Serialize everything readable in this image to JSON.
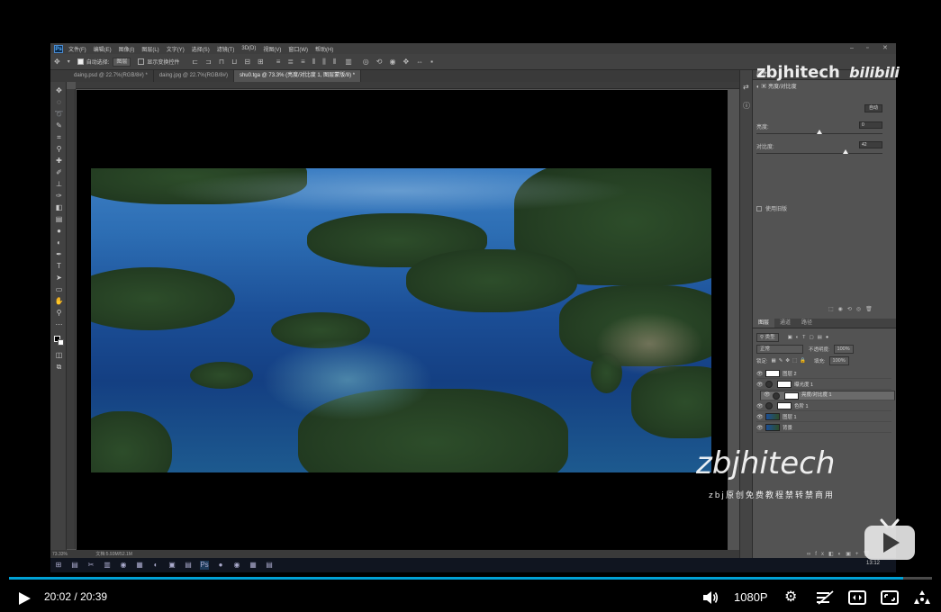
{
  "ps": {
    "logo": "Ps",
    "menu": [
      "文件(F)",
      "编辑(E)",
      "图像(I)",
      "图层(L)",
      "文字(Y)",
      "选择(S)",
      "滤镜(T)",
      "3D(D)",
      "视图(V)",
      "窗口(W)",
      "帮助(H)"
    ],
    "options": {
      "auto_select_label": "自动选择:",
      "auto_select_value": "图层",
      "show_transform_label": "显示变换控件"
    },
    "tabs": [
      {
        "label": "daing.psd @ 22.7%(RGB/8#) *",
        "active": false
      },
      {
        "label": "daing.jpg @ 22.7%(RGB/8#)",
        "active": false
      },
      {
        "label": "shu0.tga @ 73.3% (亮度/对比度 1, 图层蒙版/8) *",
        "active": true
      }
    ],
    "status": {
      "zoom": "73.33%",
      "doc": "文档:5.93M/52.1M"
    },
    "properties": {
      "header": "属性",
      "title": "亮度/对比度",
      "auto_label": "自动",
      "brightness_label": "亮度:",
      "brightness_value": "0",
      "brightness_level": 0.5,
      "contrast_label": "对比度:",
      "contrast_value": "42",
      "contrast_level": 0.71,
      "legacy_label": "使用旧版"
    },
    "layers": {
      "tabs": [
        "图层",
        "通道",
        "路径"
      ],
      "kind_label": "类型",
      "blend_mode": "正常",
      "opacity_label": "不透明度:",
      "opacity_value": "100%",
      "lock_label": "锁定:",
      "fill_label": "填充:",
      "fill_value": "100%",
      "items": [
        {
          "name": "图层 2",
          "thumb": "white",
          "selected": false
        },
        {
          "name": "曝光度 1",
          "thumb": "adj",
          "selected": false
        },
        {
          "name": "亮度/对比度 1",
          "thumb": "adj",
          "selected": true
        },
        {
          "name": "色阶 1",
          "thumb": "adj",
          "selected": false
        },
        {
          "name": "图层 1",
          "thumb": "photo",
          "selected": false
        },
        {
          "name": "背景",
          "thumb": "photo",
          "selected": false
        }
      ]
    }
  },
  "taskbar": {
    "clock": "13:12"
  },
  "player": {
    "current_time": "20:02",
    "separator": "/",
    "duration": "20:39",
    "progress": 0.969,
    "quality": "1080P"
  },
  "watermarks": {
    "top": "zbjhitech",
    "top_brand": "bilibili",
    "bottom": "zbjhitech",
    "bottom_sub_prefix": "zbj",
    "bottom_sub": "原创免费教程禁转禁商用"
  },
  "colors": {
    "progress": "#00a1d6",
    "ps_dark": "#424242",
    "ps_panel": "#535353"
  }
}
